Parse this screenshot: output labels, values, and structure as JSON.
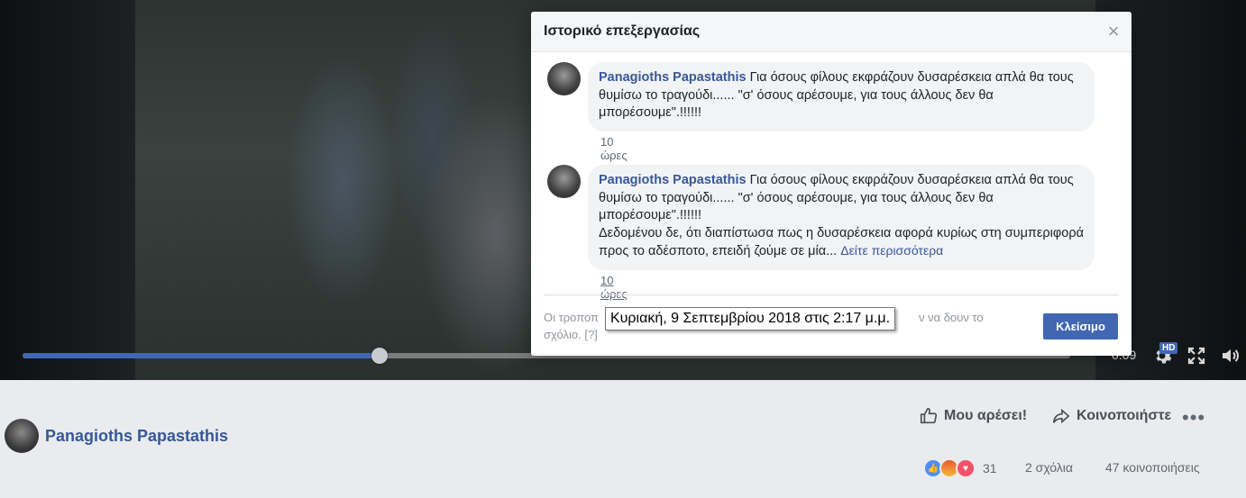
{
  "video": {
    "progress_fraction": 0.341,
    "time_label": "0:09",
    "quality_badge": "HD",
    "icons": [
      "settings-icon",
      "fullscreen-icon",
      "volume-icon"
    ]
  },
  "post": {
    "author": "Panagioths Papastathis",
    "actions": {
      "like": "Μου αρέσει!",
      "share": "Κοινοποιήστε",
      "more": "•••"
    },
    "reactions_count": "31",
    "comments": "2 σχόλια",
    "shares": "47 κοινοποιήσεις"
  },
  "dialog": {
    "title": "Ιστορικό επεξεργασίας",
    "close_glyph": "×",
    "comments": [
      {
        "author": "Panagioths Papastathis",
        "text": "Για όσους φίλους εκφράζουν δυσαρέσκεια απλά θα τους θυμίσω το τραγούδι...... \"σ' όσους αρέσουμε, για τους άλλους δεν θα μπορέσουμε\".!!!!!!",
        "time": "10 ώρες"
      },
      {
        "author": "Panagioths Papastathis",
        "text": "Για όσους φίλους εκφράζουν δυσαρέσκεια απλά θα τους θυμίσω το τραγούδι...... \"σ' όσους αρέσουμε, για τους άλλους δεν θα μπορέσουμε\".!!!!!!",
        "text2": "Δεδομένου δε, ότι διαπίστωσα πως η δυσαρέσκεια αφορά κυρίως στη συμπεριφορά προς το αδέσποτο, επειδή ζούμε σε μία...",
        "see_more": "Δείτε περισσότερα",
        "time": "10 ώρες"
      }
    ],
    "footnote_start": "Οι τροποπ",
    "footnote_end": "ν να δουν το",
    "footnote_line2": "σχόλιο.",
    "footnote_help": "[?]",
    "close_button": "Κλείσιμο"
  },
  "tooltip": "Κυριακή, 9 Σεπτεμβρίου 2018 στις 2:17 μ.μ.",
  "colors": {
    "accent": "#4267b2",
    "link": "#385898",
    "bubble": "#f2f3f5"
  }
}
